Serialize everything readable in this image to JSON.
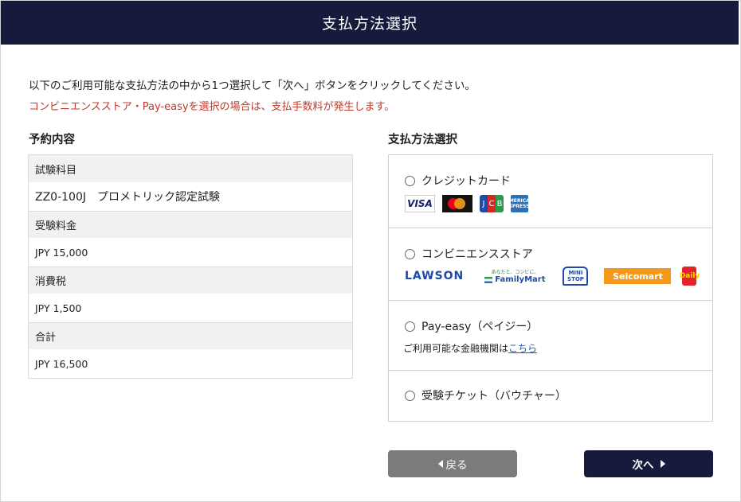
{
  "header": {
    "title": "支払方法選択"
  },
  "intro": {
    "instruction": "以下のご利用可能な支払方法の中から1つ選択して「次へ」ボタンをクリックしてください。",
    "fee_notice": "コンビニエンスストア・Pay-easyを選択の場合は、支払手数料が発生します。"
  },
  "summary": {
    "title": "予約内容",
    "rows": [
      {
        "label": "試験科目",
        "value": "ZZ0-100J　プロメトリック認定試験"
      },
      {
        "label": "受験料金",
        "value": "JPY 15,000"
      },
      {
        "label": "消費税",
        "value": "JPY 1,500"
      },
      {
        "label": "合計",
        "value": "JPY 16,500"
      }
    ]
  },
  "payment": {
    "title": "支払方法選択",
    "methods": [
      {
        "label": "クレジットカード",
        "selected": false
      },
      {
        "label": "コンビニエンスストア",
        "selected": false
      },
      {
        "label": "Pay-easy（ペイジー）",
        "selected": false,
        "note_prefix": "ご利用可能な金融機関は",
        "note_link": "こちら"
      },
      {
        "label": "受験チケット（バウチャー）",
        "selected": false
      }
    ],
    "card_logos": {
      "visa": "VISA",
      "jcb": [
        "J",
        "C",
        "B"
      ],
      "amex": "AMERICAN EXPRESS"
    },
    "store_logos": {
      "lawson": "LAWSON",
      "familymart_tagline": "あなたと、コンビに、",
      "familymart": "FamilyMart",
      "ministop": [
        "MINI",
        "STOP"
      ],
      "seicomart": "Seicomart",
      "daily": "Daily"
    },
    "icons": {
      "mastercard": "mastercard-logo-icon",
      "back_arrow": "triangle-left-icon",
      "next_arrow": "triangle-right-icon"
    }
  },
  "buttons": {
    "back": "戻る",
    "next": "次へ"
  },
  "colors": {
    "header_bg": "#161b3d",
    "notice": "#c0392b",
    "back_button": "#7b7b7b",
    "link": "#1a5fb4"
  }
}
